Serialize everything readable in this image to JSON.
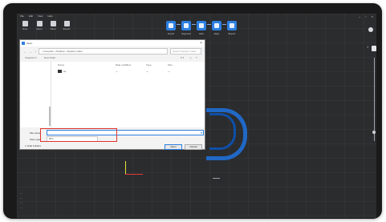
{
  "menu": [
    "File",
    "Edit",
    "View",
    "Help"
  ],
  "window_controls": [
    "–",
    "▫",
    "×"
  ],
  "toolbar": [
    {
      "label": "New",
      "icon": "new-icon"
    },
    {
      "label": "Open",
      "icon": "open-icon"
    },
    {
      "label": "Save",
      "icon": "save-icon"
    },
    {
      "label": "Export",
      "icon": "export-icon"
    }
  ],
  "workflow_steps": [
    {
      "label": "Import"
    },
    {
      "label": "Segment"
    },
    {
      "label": "Edit"
    },
    {
      "label": "Align"
    },
    {
      "label": "Export"
    }
  ],
  "zoom": {
    "label": "1"
  },
  "status_lines": [
    "—",
    "—",
    "—",
    "—"
  ],
  "dialog": {
    "title": "Open",
    "close": "×",
    "breadcrumb": "› Computer › Desktop › Sample model",
    "search_placeholder": "Search Sample model",
    "nav_back": "←",
    "nav_forward": "→",
    "nav_up": "↑",
    "toolbar_items": [
      "Organize ▾",
      "New folder"
    ],
    "view_controls": [
      "≡ ▾",
      "▢",
      "?"
    ],
    "columns": [
      "Name",
      "Date modified",
      "Type",
      "Size"
    ],
    "files": [
      {
        "name": "▪▪▪",
        "date": "—",
        "type": "—",
        "size": "—"
      }
    ],
    "file_name_label": "File name:",
    "file_name_value": "",
    "save_type_label": "Save type:",
    "save_type_value": "STL",
    "hide_folders": "∧ Hide Folders",
    "open_button": "Open",
    "cancel_button": "Cancel"
  },
  "colors": {
    "accent": "#2d7fe0",
    "highlight": "#e0342c",
    "background": "#2b2c2e"
  }
}
